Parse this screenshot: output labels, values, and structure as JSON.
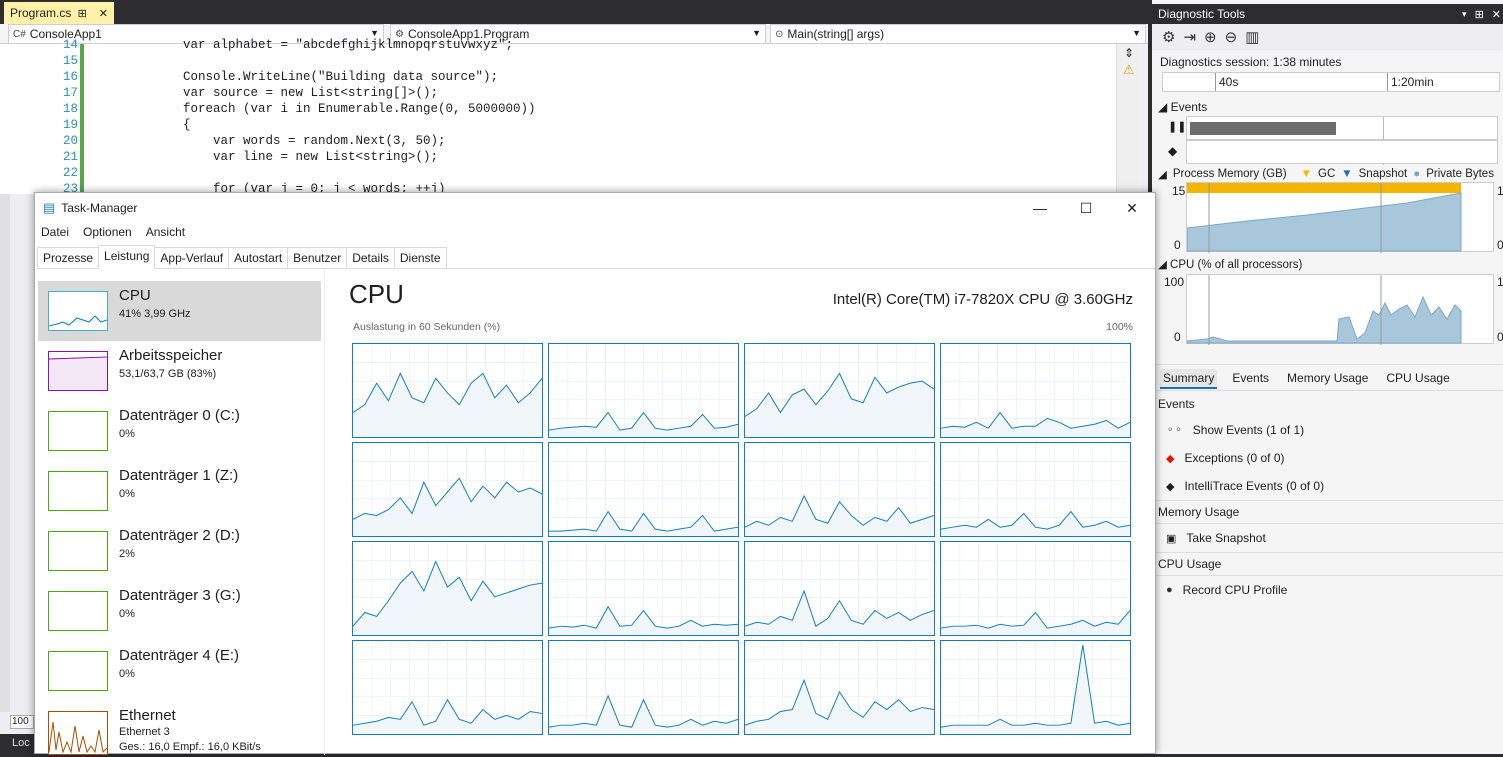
{
  "editor": {
    "tab_title": "Program.cs",
    "tab_pin": "⊞",
    "tab_close": "✕",
    "dropdowns": [
      {
        "icon": "C#",
        "label": "ConsoleApp1"
      },
      {
        "icon": "⚙",
        "label": "ConsoleApp1.Program"
      },
      {
        "icon": "⊙",
        "label": "Main(string[] args)"
      }
    ],
    "lines": [
      {
        "n": "14",
        "text": "var alphabet = \"abcdefghijklmnopqrstuvwxyz\";"
      },
      {
        "n": "15",
        "text": ""
      },
      {
        "n": "16",
        "text": "Console.WriteLine(\"Building data source\");"
      },
      {
        "n": "17",
        "text": "var source = new List<string[]>();"
      },
      {
        "n": "18",
        "text": "foreach (var i in Enumerable.Range(0, 5000000))"
      },
      {
        "n": "19",
        "text": "{"
      },
      {
        "n": "20",
        "text": "    var words = random.Next(3, 50);"
      },
      {
        "n": "21",
        "text": "    var line = new List<string>();"
      },
      {
        "n": "22",
        "text": ""
      },
      {
        "n": "23",
        "text": "    for (var j = 0; j < words; ++j)"
      }
    ],
    "zoom": "100",
    "status_left": "Loc"
  },
  "diag": {
    "title": "Diagnostic Tools",
    "session": "Diagnostics session: 1:38 minutes",
    "ticks": [
      "40s",
      "1:20min"
    ],
    "events_label": "Events",
    "memory_label": "Process Memory (GB)",
    "legend": [
      "GC",
      "Snapshot",
      "Private Bytes"
    ],
    "mem_max": "15",
    "mem_min": "0",
    "mem_right_max": "1",
    "mem_right_min": "0",
    "cpu_label": "CPU (% of all processors)",
    "cpu_max": "100",
    "cpu_min": "0",
    "cpu_right_max": "1",
    "cpu_right_min": "0",
    "tabs": [
      "Summary",
      "Events",
      "Memory Usage",
      "CPU Usage"
    ],
    "sec_events": "Events",
    "show_events": "Show Events (1 of 1)",
    "exceptions": "Exceptions (0 of 0)",
    "intellitrace": "IntelliTrace Events (0 of 0)",
    "sec_memory": "Memory Usage",
    "take_snapshot": "Take Snapshot",
    "sec_cpu": "CPU Usage",
    "record_cpu": "Record CPU Profile"
  },
  "taskmgr": {
    "title": "Task-Manager",
    "menu": [
      "Datei",
      "Optionen",
      "Ansicht"
    ],
    "tabs": [
      "Prozesse",
      "Leistung",
      "App-Verlauf",
      "Autostart",
      "Benutzer",
      "Details",
      "Dienste"
    ],
    "side": [
      {
        "name": "CPU",
        "sub": "41% 3,99 GHz"
      },
      {
        "name": "Arbeitsspeicher",
        "sub": "53,1/63,7 GB (83%)"
      },
      {
        "name": "Datenträger 0 (C:)",
        "sub": "0%"
      },
      {
        "name": "Datenträger 1 (Z:)",
        "sub": "0%"
      },
      {
        "name": "Datenträger 2 (D:)",
        "sub": "2%"
      },
      {
        "name": "Datenträger 3 (G:)",
        "sub": "0%"
      },
      {
        "name": "Datenträger 4 (E:)",
        "sub": "0%"
      },
      {
        "name": "Ethernet",
        "sub": "Ethernet 3",
        "sub2": "Ges.: 16,0 Empf.: 16,0 KBit/s"
      }
    ],
    "cpu_heading": "CPU",
    "cpu_model": "Intel(R) Core(TM) i7-7820X CPU @ 3.60GHz",
    "util_label": "Auslastung in 60 Sekunden (%)",
    "util_max": "100%"
  }
}
